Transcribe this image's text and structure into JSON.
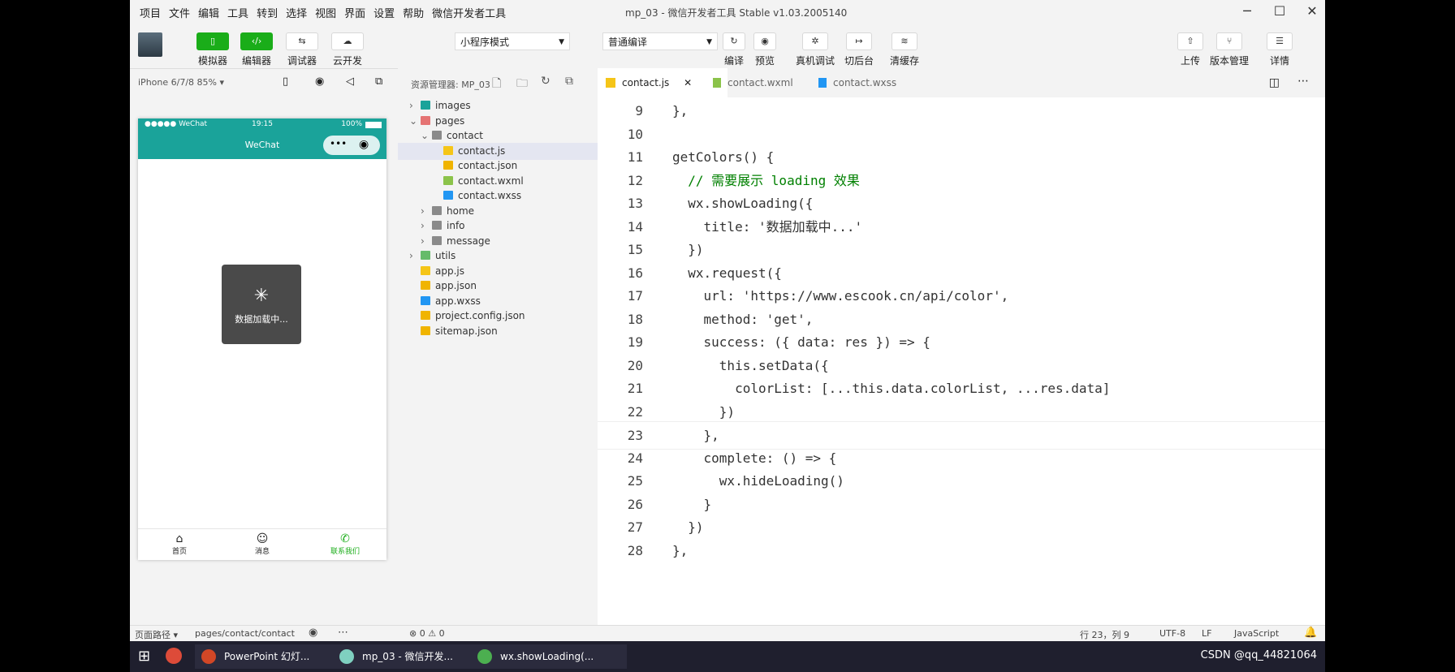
{
  "menubar": {
    "items": [
      "项目",
      "文件",
      "编辑",
      "工具",
      "转到",
      "选择",
      "视图",
      "界面",
      "设置",
      "帮助",
      "微信开发者工具"
    ],
    "title": "mp_03 - 微信开发者工具 Stable v1.03.2005140"
  },
  "toolbar": {
    "simulator": "模拟器",
    "editor": "编辑器",
    "debugger": "调试器",
    "cloud": "云开发",
    "mode": "小程序模式",
    "compile_mode": "普通编译",
    "compile": "编译",
    "preview": "预览",
    "remote_debug": "真机调试",
    "background": "切后台",
    "clear_cache": "清缓存",
    "upload": "上传",
    "version": "版本管理",
    "details": "详情"
  },
  "simulator": {
    "device": "iPhone 6/7/8 85%",
    "carrier": "●●●●● WeChat",
    "time": "19:15",
    "battery": "100%",
    "nav_title": "WeChat",
    "loading_text": "数据加载中...",
    "tabs": [
      {
        "label": "首页"
      },
      {
        "label": "消息"
      },
      {
        "label": "联系我们"
      }
    ]
  },
  "explorer": {
    "header": "资源管理器: MP_03",
    "tree": [
      {
        "label": "images",
        "indent": 1,
        "type": "folder-img"
      },
      {
        "label": "pages",
        "indent": 1,
        "type": "folder-red"
      },
      {
        "label": "contact",
        "indent": 2,
        "type": "folder"
      },
      {
        "label": "contact.js",
        "indent": 3,
        "type": "js",
        "selected": true
      },
      {
        "label": "contact.json",
        "indent": 3,
        "type": "json"
      },
      {
        "label": "contact.wxml",
        "indent": 3,
        "type": "wxml"
      },
      {
        "label": "contact.wxss",
        "indent": 3,
        "type": "wxss"
      },
      {
        "label": "home",
        "indent": 2,
        "type": "folder"
      },
      {
        "label": "info",
        "indent": 2,
        "type": "folder"
      },
      {
        "label": "message",
        "indent": 2,
        "type": "folder"
      },
      {
        "label": "utils",
        "indent": 1,
        "type": "folder-green"
      },
      {
        "label": "app.js",
        "indent": 1,
        "type": "js"
      },
      {
        "label": "app.json",
        "indent": 1,
        "type": "json"
      },
      {
        "label": "app.wxss",
        "indent": 1,
        "type": "wxss"
      },
      {
        "label": "project.config.json",
        "indent": 1,
        "type": "json"
      },
      {
        "label": "sitemap.json",
        "indent": 1,
        "type": "json"
      }
    ]
  },
  "editor": {
    "tabs": [
      "contact.js",
      "contact.wxml",
      "contact.wxss"
    ],
    "lines": [
      {
        "n": "9",
        "code": "},"
      },
      {
        "n": "10",
        "code": ""
      },
      {
        "n": "11",
        "code": "getColors() {"
      },
      {
        "n": "12",
        "code": "  // 需要展示 loading 效果"
      },
      {
        "n": "13",
        "code": "  wx.showLoading({"
      },
      {
        "n": "14",
        "code": "    title: '数据加载中...'"
      },
      {
        "n": "15",
        "code": "  })"
      },
      {
        "n": "16",
        "code": "  wx.request({"
      },
      {
        "n": "17",
        "code": "    url: 'https://www.escook.cn/api/color',"
      },
      {
        "n": "18",
        "code": "    method: 'get',"
      },
      {
        "n": "19",
        "code": "    success: ({ data: res }) => {"
      },
      {
        "n": "20",
        "code": "      this.setData({"
      },
      {
        "n": "21",
        "code": "        colorList: [...this.data.colorList, ...res.data]"
      },
      {
        "n": "22",
        "code": "      })"
      },
      {
        "n": "23",
        "code": "    },"
      },
      {
        "n": "24",
        "code": "    complete: () => {"
      },
      {
        "n": "25",
        "code": "      wx.hideLoading()"
      },
      {
        "n": "26",
        "code": "    }"
      },
      {
        "n": "27",
        "code": "  })"
      },
      {
        "n": "28",
        "code": "},"
      }
    ]
  },
  "statusbar": {
    "page_path_label": "页面路径",
    "page_path": "pages/contact/contact",
    "problems": "⊗ 0 ⚠ 0",
    "position": "行 23，列 9",
    "encoding": "UTF-8",
    "eol": "LF",
    "language": "JavaScript"
  },
  "taskbar": {
    "apps": [
      "PowerPoint 幻灯...",
      "mp_03 - 微信开发...",
      "wx.showLoading(..."
    ],
    "watermark": "CSDN @qq_44821064"
  },
  "colors": {
    "accent": "#1aad19",
    "navbar": "#1aa39a"
  }
}
